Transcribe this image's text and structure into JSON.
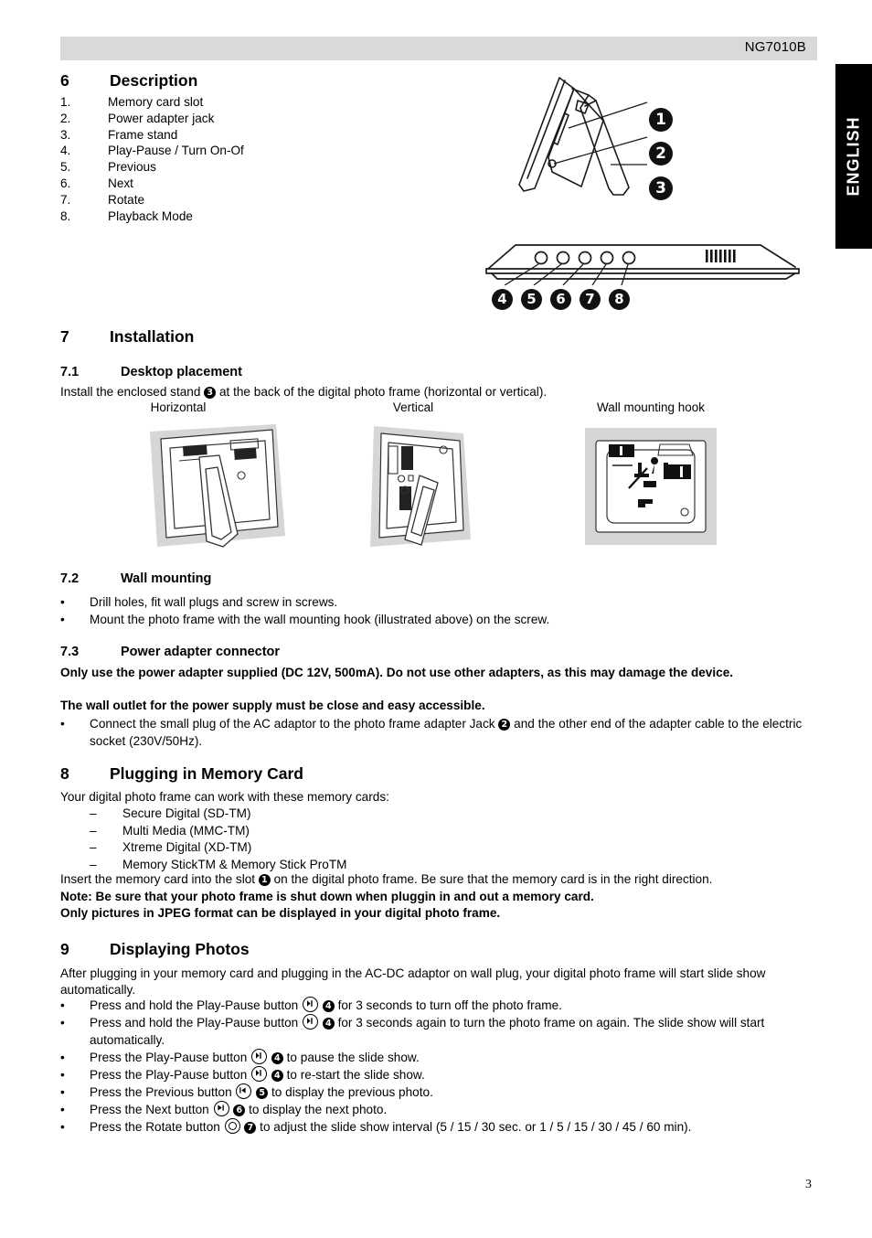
{
  "header": {
    "product_code": "NG7010B",
    "language_tab": "ENGLISH"
  },
  "footer": {
    "page_number": "3"
  },
  "sections": {
    "description": {
      "number": "6",
      "title": "Description",
      "items": [
        {
          "n": "1.",
          "label": "Memory card slot"
        },
        {
          "n": "2.",
          "label": "Power adapter jack"
        },
        {
          "n": "3.",
          "label": "Frame stand"
        },
        {
          "n": "4.",
          "label": "Play-Pause / Turn On-Of"
        },
        {
          "n": "5.",
          "label": "Previous"
        },
        {
          "n": "6.",
          "label": "Next"
        },
        {
          "n": "7.",
          "label": "Rotate"
        },
        {
          "n": "8.",
          "label": "Playback Mode"
        }
      ],
      "callouts": [
        "1",
        "2",
        "3",
        "4",
        "5",
        "6",
        "7",
        "8"
      ]
    },
    "installation": {
      "number": "7",
      "title": "Installation",
      "desktop": {
        "number": "7.1",
        "title": "Desktop placement",
        "intro_before": "Install the enclosed stand",
        "intro_badge": "3",
        "intro_after": "at the back of the digital photo frame (horizontal or vertical).",
        "captions": {
          "horizontal": "Horizontal",
          "vertical": "Vertical",
          "wall_hook": "Wall mounting hook"
        }
      },
      "wall": {
        "number": "7.2",
        "title": "Wall mounting",
        "bullets": [
          "Drill holes, fit wall plugs and screw in screws.",
          "Mount the photo frame with the wall mounting hook (illustrated above) on the screw."
        ]
      },
      "power": {
        "number": "7.3",
        "title": "Power adapter connector",
        "warning_1": "Only use the power adapter supplied (DC 12V, 500mA). Do not use other adapters, as this may damage the device.",
        "warning_2": "The wall outlet for the power supply must be close and easy accessible.",
        "bullet_before": "Connect the small plug of the AC adaptor to the photo frame adapter Jack",
        "bullet_badge": "2",
        "bullet_after": "and the other end of the adapter cable to the electric socket (230V/50Hz)."
      }
    },
    "memory": {
      "number": "8",
      "title": "Plugging in Memory Card",
      "intro": "Your digital photo frame can work with these memory cards:",
      "cards": [
        "Secure Digital (SD-TM)",
        "Multi Media (MMC-TM)",
        "Xtreme Digital (XD-TM)",
        "Memory StickTM & Memory Stick ProTM"
      ],
      "insert_before": "Insert the memory card into the slot",
      "insert_badge": "1",
      "insert_after": "on the digital photo frame. Be sure that the memory card is in the right direction.",
      "note": "Note: Be sure that your photo frame is shut down when pluggin in and out a memory card.",
      "jpeg_note": "Only pictures in JPEG format can be displayed in your digital photo frame."
    },
    "displaying": {
      "number": "9",
      "title": "Displaying Photos",
      "intro": "After plugging in your memory card and plugging in the AC-DC adaptor on wall plug, your digital photo frame will start slide show automatically.",
      "steps": [
        {
          "before": "Press and hold the Play-Pause button",
          "icon": "play-pause-icon",
          "badge": "4",
          "after": "for 3 seconds to turn off the photo frame."
        },
        {
          "before": "Press and hold the Play-Pause button",
          "icon": "play-pause-icon",
          "badge": "4",
          "after": "for 3 seconds again to turn the photo frame on again. The slide show will start automatically."
        },
        {
          "before": "Press the Play-Pause button",
          "icon": "play-pause-icon",
          "badge": "4",
          "after": "to pause the slide show."
        },
        {
          "before": "Press the Play-Pause button",
          "icon": "play-pause-icon",
          "badge": "4",
          "after": "to re-start the slide show."
        },
        {
          "before": "Press the Previous button",
          "icon": "previous-icon",
          "badge": "5",
          "after": "to display the previous photo."
        },
        {
          "before": "Press the Next button",
          "icon": "next-icon",
          "badge": "6",
          "after": "to display the next photo."
        },
        {
          "before": "Press the Rotate button",
          "icon": "rotate-icon",
          "badge": "7",
          "after": "to adjust the slide show interval (5 / 15 / 30 sec. or 1 / 5 / 15 / 30 / 45 / 60 min)."
        }
      ]
    }
  },
  "colors": {
    "header_bar": "#d9d9d9",
    "lang_tab": "#000000",
    "text": "#000000",
    "illustration_shadow": "#d6d6d6"
  }
}
